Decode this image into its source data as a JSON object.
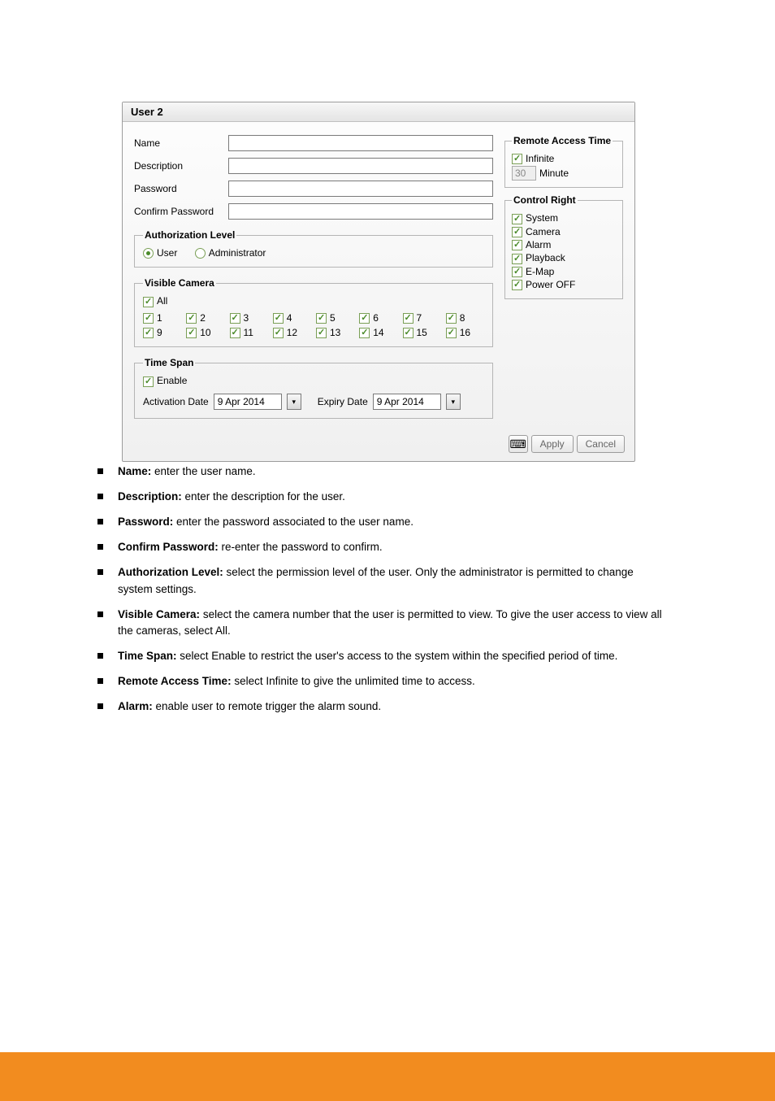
{
  "dialog": {
    "title": "User 2",
    "fields": {
      "name_label": "Name",
      "name_value": "",
      "desc_label": "Description",
      "desc_value": "",
      "pw_label": "Password",
      "pw_value": "",
      "cpw_label": "Confirm Password",
      "cpw_value": ""
    },
    "auth": {
      "legend": "Authorization Level",
      "user": "User",
      "admin": "Administrator",
      "selected": "user"
    },
    "visible_camera": {
      "legend": "Visible Camera",
      "all_label": "All",
      "cameras": [
        "1",
        "2",
        "3",
        "4",
        "5",
        "6",
        "7",
        "8",
        "9",
        "10",
        "11",
        "12",
        "13",
        "14",
        "15",
        "16"
      ]
    },
    "timespan": {
      "legend": "Time Span",
      "enable": "Enable",
      "activation_label": "Activation Date",
      "activation_value": "9 Apr 2014",
      "expiry_label": "Expiry Date",
      "expiry_value": "9 Apr 2014"
    },
    "remote_access": {
      "legend": "Remote Access Time",
      "infinite": "Infinite",
      "minute_value": "30",
      "minute_label": "Minute"
    },
    "control_right": {
      "legend": "Control Right",
      "items": [
        "System",
        "Camera",
        "Alarm",
        "Playback",
        "E-Map",
        "Power OFF"
      ]
    },
    "buttons": {
      "apply": "Apply",
      "cancel": "Cancel"
    }
  },
  "bullets": [
    {
      "term": "Name:",
      "desc": " enter the user name."
    },
    {
      "term": "Description:",
      "desc": " enter the description for the user."
    },
    {
      "term": "Password:",
      "desc": " enter the password associated to the user name."
    },
    {
      "term": "Confirm Password:",
      "desc": " re-enter the password to confirm."
    },
    {
      "term": "Authorization Level:",
      "desc": " select the permission level of the user. Only the administrator is permitted to change system settings."
    },
    {
      "term": "Visible Camera:",
      "desc": " select the camera number that the user is permitted to view. To give the user access to view all the cameras, select All."
    },
    {
      "term": "Time Span:",
      "desc": " select Enable to restrict the user's access to the system within the specified period of time."
    },
    {
      "term": "Remote Access Time:",
      "desc": " select Infinite to give the unlimited time to access."
    },
    {
      "term": "Alarm:",
      "desc": " enable user to remote trigger the alarm sound."
    }
  ]
}
